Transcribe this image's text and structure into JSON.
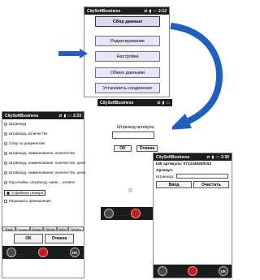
{
  "app_title": "CitySoftBusiness",
  "main_screen": {
    "time": "2:12",
    "buttons": [
      {
        "label": "Сбор данных",
        "active": true
      },
      {
        "label": "Редактирование"
      },
      {
        "label": "Настройки"
      },
      {
        "label": "Обмен данными"
      },
      {
        "label": "Установить соединение"
      }
    ]
  },
  "settings_screen": {
    "time": "2:33",
    "options": [
      {
        "label": "Штрихкод",
        "selected": false
      },
      {
        "label": "Штрихкод, количество",
        "selected": false
      },
      {
        "label": "Сбор по документам",
        "selected": false
      },
      {
        "label": "Штрихкод, наименование, количество",
        "selected": false
      },
      {
        "label": "Штрихкод, наименование, количество, цена",
        "selected": false
      },
      {
        "label": "Штрихкод, наименование, количество, цена",
        "selected": false
      },
      {
        "label": "Код ячейки, штрихкод, наим..., количе",
        "selected": false
      },
      {
        "label": "Серийные номера",
        "selected": true
      }
    ],
    "checkbox_label": "Разрешить превышение",
    "tabs": [
      "Язык",
      "Режимы",
      "Маски",
      "Общие",
      "Файл",
      "Печать"
    ],
    "ok": "OK",
    "cancel": "Отмена"
  },
  "article_dialog": {
    "label": "Штрихкод артикула:",
    "ok": "OK",
    "cancel": "Отмена"
  },
  "result_screen": {
    "time": "2:36",
    "barcode_line": "ШК артикула: 0712345260152",
    "article_label": "Артикул:",
    "barcode_label": "Штрихкод:",
    "enter": "Ввод",
    "clear": "Очистить"
  },
  "taskbar_ok": "OK"
}
